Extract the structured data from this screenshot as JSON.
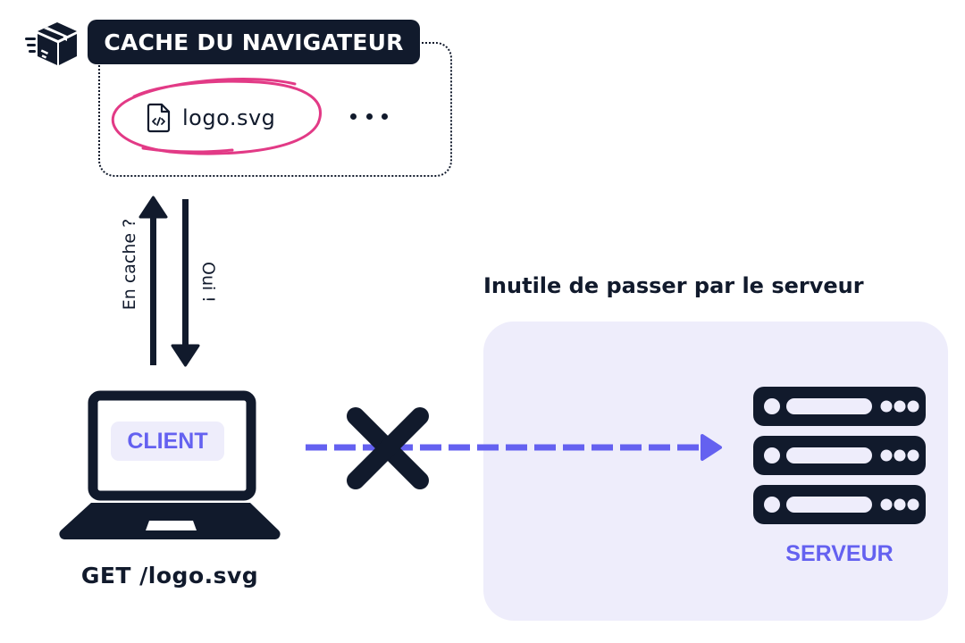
{
  "colors": {
    "dark": "#111a2c",
    "accent": "#6461f0",
    "accent_light": "#eeedfb",
    "highlight": "#e23a86",
    "background": "#ffffff"
  },
  "cache": {
    "title": "CACHE DU NAVIGATEUR",
    "icon": "package-box-icon",
    "items": [
      {
        "name": "logo.svg",
        "icon": "code-file-icon",
        "highlighted": true
      }
    ],
    "more_indicator": "more-items-ellipsis"
  },
  "exchange": {
    "request_label": "En cache ?",
    "response_label": "Oui !"
  },
  "client": {
    "label": "CLIENT",
    "request": "GET /logo.svg",
    "icon": "laptop-icon"
  },
  "server": {
    "heading": "Inutile de passer par le serveur",
    "label": "SERVEUR",
    "icon": "server-stack-icon"
  },
  "connection": {
    "style": "dashed",
    "blocked": true,
    "blocked_icon": "cross-icon"
  }
}
